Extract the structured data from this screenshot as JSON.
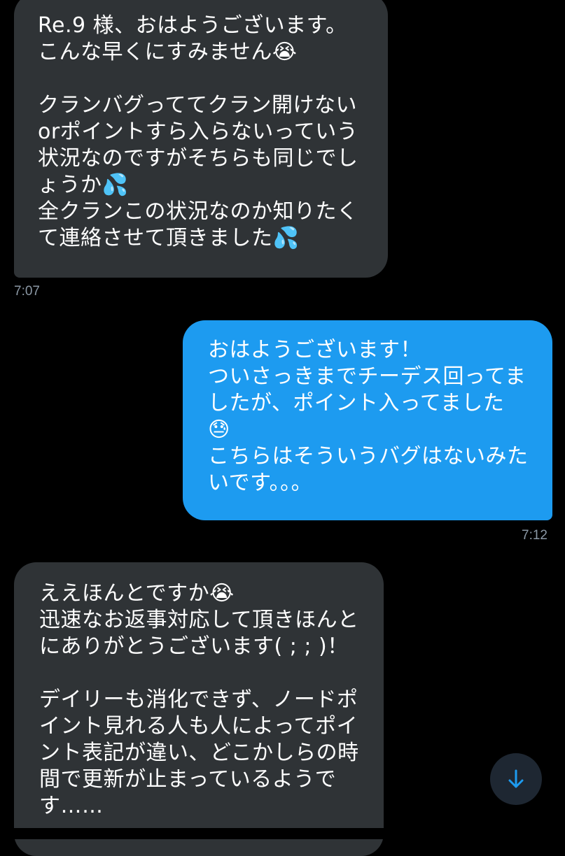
{
  "messages": [
    {
      "direction": "incoming",
      "text": "Re.9 様、おはようございます。\nこんな早くにすみません😭\n\nクランバグっててクラン開けない\norポイントすら入らないっていう\n状況なのですがそちらも同じでし\nょうか💦\n全クランこの状況なのか知りたく\nて連絡させて頂きました💦",
      "time": "7:07"
    },
    {
      "direction": "outgoing",
      "text": "おはようございます！\nついさっきまでチーデス回ってま\nしたが、ポイント入ってました\n😓\nこちらはそういうバグはないみた\nいです。。。",
      "time": "7:12"
    },
    {
      "direction": "incoming",
      "text": "ええほんとですか😭\n迅速なお返事対応して頂きほんと\nにありがとうございます( ; ; )！\n\nデイリーも消化できず、ノードポ\nイント見れる人も人によってポイ\nント表記が違い、どこかしらの時\n間で更新が止まっているようで\nす……"
    }
  ],
  "scroll_button": {
    "icon": "arrow-down-icon"
  },
  "colors": {
    "background": "#000000",
    "incoming_bubble": "#2f3336",
    "outgoing_bubble": "#1d9bf0",
    "timestamp": "#8b98a5",
    "accent": "#1d9bf0"
  }
}
